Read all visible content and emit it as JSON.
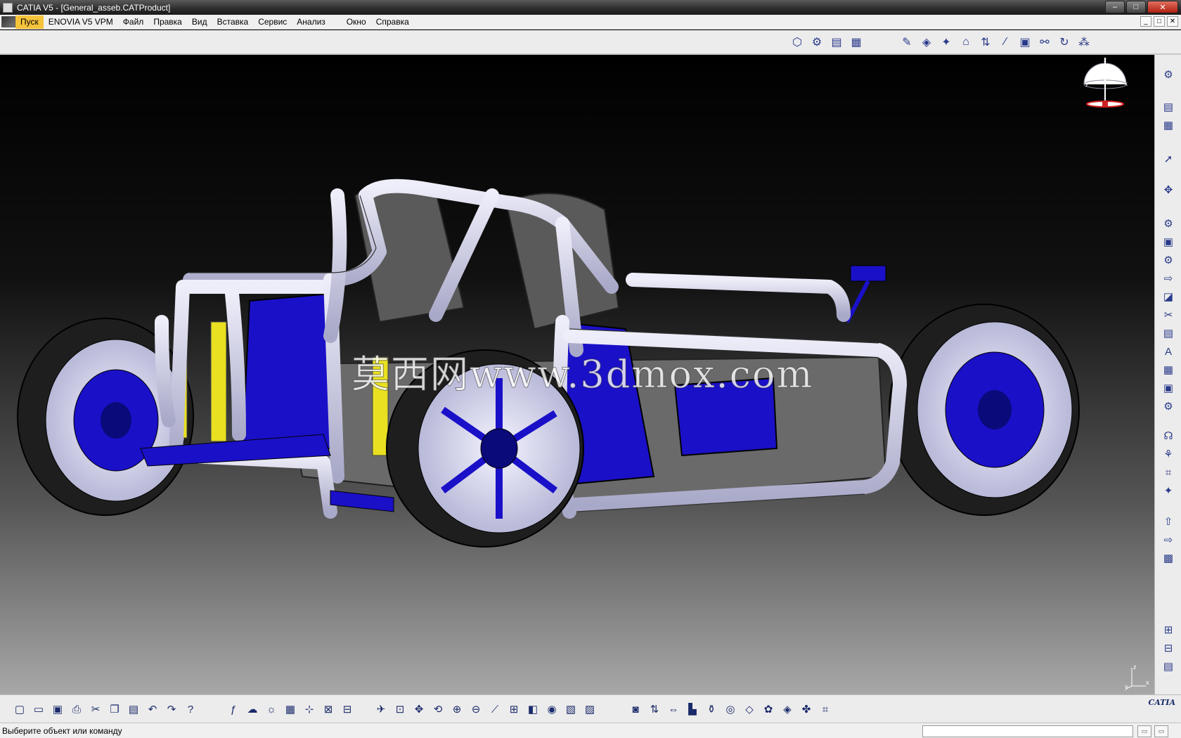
{
  "window": {
    "title": "CATIA V5 - [General_asseb.CATProduct]",
    "minimize": "–",
    "maximize": "□",
    "close": "✕"
  },
  "menu": {
    "items": [
      {
        "label": "Пуск"
      },
      {
        "label": "ENOVIA V5 VPM"
      },
      {
        "label": "Файл"
      },
      {
        "label": "Правка"
      },
      {
        "label": "Вид"
      },
      {
        "label": "Вставка"
      },
      {
        "label": "Сервис"
      },
      {
        "label": "Анализ"
      },
      {
        "label": "Окно"
      },
      {
        "label": "Справка"
      }
    ],
    "mdi": [
      "_",
      "□",
      "✕"
    ]
  },
  "viewport": {
    "watermark": "莫西网www.3dmox.com",
    "compass_z": "z",
    "compass_y": "y",
    "compass_x": "x",
    "axis_z": "z",
    "axis_y": "y",
    "axis_x": "x"
  },
  "status": {
    "message": "Выберите объект или команду",
    "command_value": ""
  },
  "brand": {
    "logo": "CATIA"
  },
  "colors": {
    "frame": "#c8c8e0",
    "blue_parts": "#1a10c8",
    "shocks": "#e8e020",
    "tires": "#1e1e1e"
  }
}
